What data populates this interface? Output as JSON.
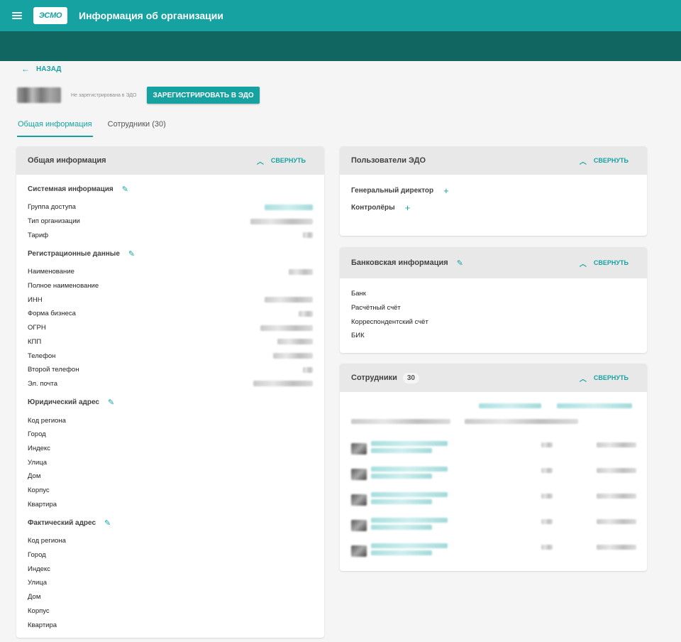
{
  "header": {
    "logo_text": "ЭСМО",
    "title": "Информация об организации"
  },
  "back_label": "НАЗАД",
  "org": {
    "status": "Не зарегистрирована в ЭДО",
    "register_button": "ЗАРЕГИСТРИРОВАТЬ В ЭДО"
  },
  "tabs": [
    {
      "label": "Общая информация",
      "active": true
    },
    {
      "label": "Сотрудники (30)",
      "active": false
    }
  ],
  "general": {
    "title": "Общая информация",
    "collapse_label": "СВЕРНУТЬ",
    "system": {
      "title": "Системная информация",
      "rows": [
        "Группа доступа",
        "Тип организации",
        "Тариф"
      ]
    },
    "registration": {
      "title": "Регистрационные данные",
      "rows": [
        "Наименование",
        "Полное наименование",
        "ИНН",
        "Форма бизнеса",
        "ОГРН",
        "КПП",
        "Телефон",
        "Второй телефон",
        "Эл. почта"
      ]
    },
    "legal_address": {
      "title": "Юридический адрес",
      "rows": [
        "Код региона",
        "Город",
        "Индекс",
        "Улица",
        "Дом",
        "Корпус",
        "Квартира"
      ]
    },
    "actual_address": {
      "title": "Фактический адрес",
      "rows": [
        "Код региона",
        "Город",
        "Индекс",
        "Улица",
        "Дом",
        "Корпус",
        "Квартира"
      ]
    }
  },
  "edo_users": {
    "title": "Пользователи ЭДО",
    "collapse_label": "СВЕРНУТЬ",
    "director": "Генеральный директор",
    "controllers": "Контролёры",
    "plus": "+"
  },
  "bank": {
    "title": "Банковская информация",
    "collapse_label": "СВЕРНУТЬ",
    "rows": [
      "Банк",
      "Расчётный счёт",
      "Корреспондентский счёт",
      "БИК"
    ]
  },
  "employees": {
    "title": "Сотрудники",
    "count": "30",
    "collapse_label": "СВЕРНУТЬ"
  },
  "icons": {
    "edit": "pencil-icon",
    "collapse": "chevron-up-icon",
    "back": "arrow-left-icon",
    "menu": "hamburger-icon"
  },
  "colors": {
    "primary": "#17a2a2",
    "subheader": "#116662"
  }
}
